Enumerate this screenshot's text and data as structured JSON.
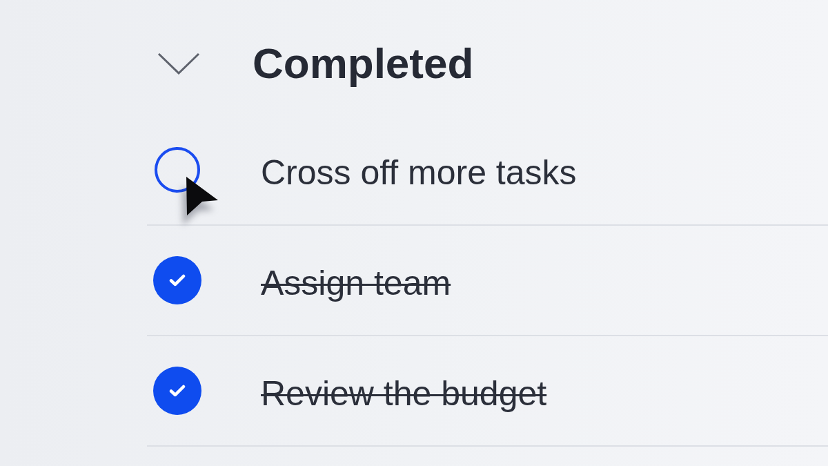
{
  "section": {
    "title": "Completed",
    "expanded": true
  },
  "tasks": [
    {
      "title": "Cross off more tasks",
      "checked": false
    },
    {
      "title": "Assign team",
      "checked": true
    },
    {
      "title": "Review the budget",
      "checked": true
    }
  ]
}
